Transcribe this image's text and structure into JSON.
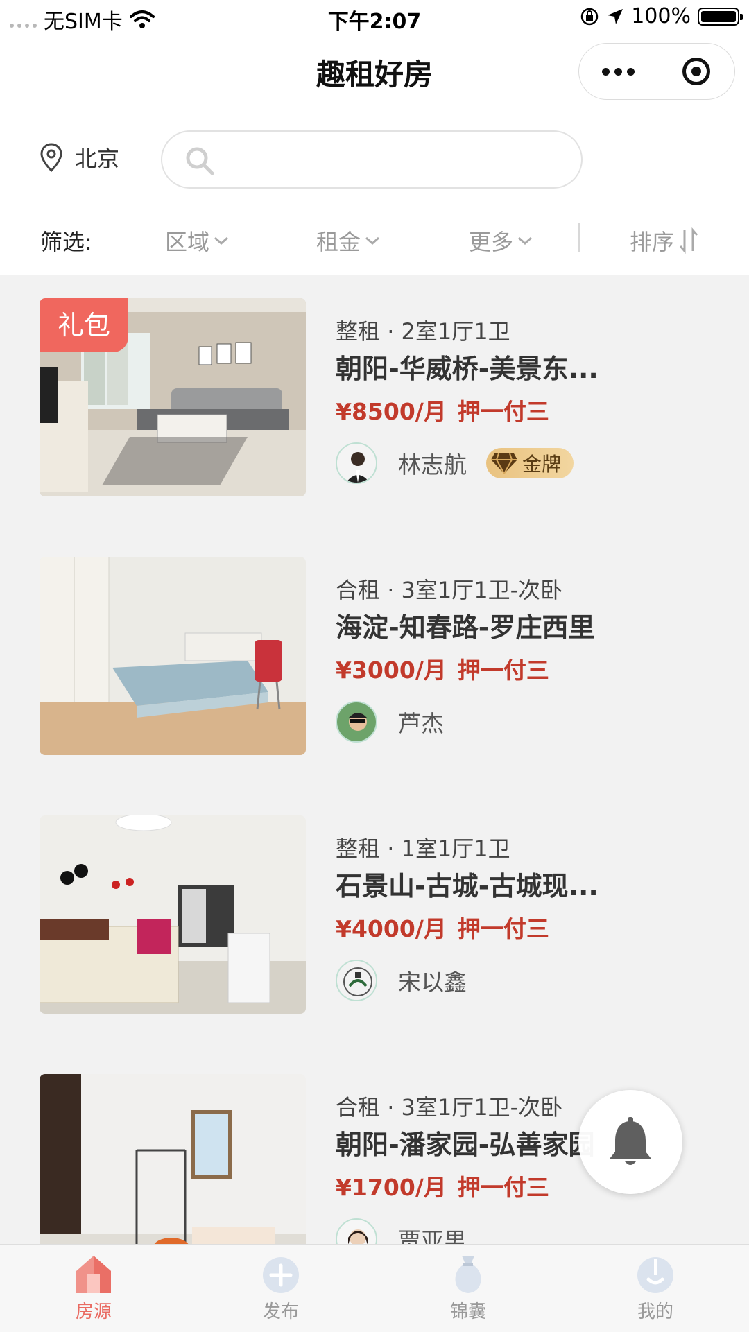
{
  "status_bar": {
    "carrier": "无SIM卡",
    "time": "下午2:07",
    "battery": "100%"
  },
  "nav": {
    "title": "趣租好房"
  },
  "location": {
    "city": "北京"
  },
  "search": {
    "placeholder": ""
  },
  "filters": {
    "label": "筛选:",
    "area": "区域",
    "rent": "租金",
    "more": "更多",
    "sort": "排序"
  },
  "listings": [
    {
      "type": "整租",
      "layout": "2室1厅1卫",
      "title": "朝阳-华威桥-美景东...",
      "price": "¥8500/月",
      "deposit": "押一付三",
      "agent": "林志航",
      "badge": "金牌",
      "tag": "礼包"
    },
    {
      "type": "合租",
      "layout": "3室1厅1卫-次卧",
      "title": "海淀-知春路-罗庄西里",
      "price": "¥3000/月",
      "deposit": "押一付三",
      "agent": "芦杰"
    },
    {
      "type": "整租",
      "layout": "1室1厅1卫",
      "title": "石景山-古城-古城现...",
      "price": "¥4000/月",
      "deposit": "押一付三",
      "agent": "宋以鑫"
    },
    {
      "type": "合租",
      "layout": "3室1厅1卫-次卧",
      "title": "朝阳-潘家园-弘善家园",
      "price": "¥1700/月",
      "deposit": "押一付三",
      "agent": "贾亚男"
    }
  ],
  "tabbar": {
    "items": [
      {
        "label": "房源",
        "icon": "house-icon",
        "active": true
      },
      {
        "label": "发布",
        "icon": "plus-icon"
      },
      {
        "label": "锦囊",
        "icon": "bag-icon"
      },
      {
        "label": "我的",
        "icon": "profile-icon"
      }
    ]
  },
  "colors": {
    "price": "#c23a2b",
    "accent": "#e96b62",
    "gold_badge": "#e9c27f",
    "gift_badge": "#f0675e"
  }
}
